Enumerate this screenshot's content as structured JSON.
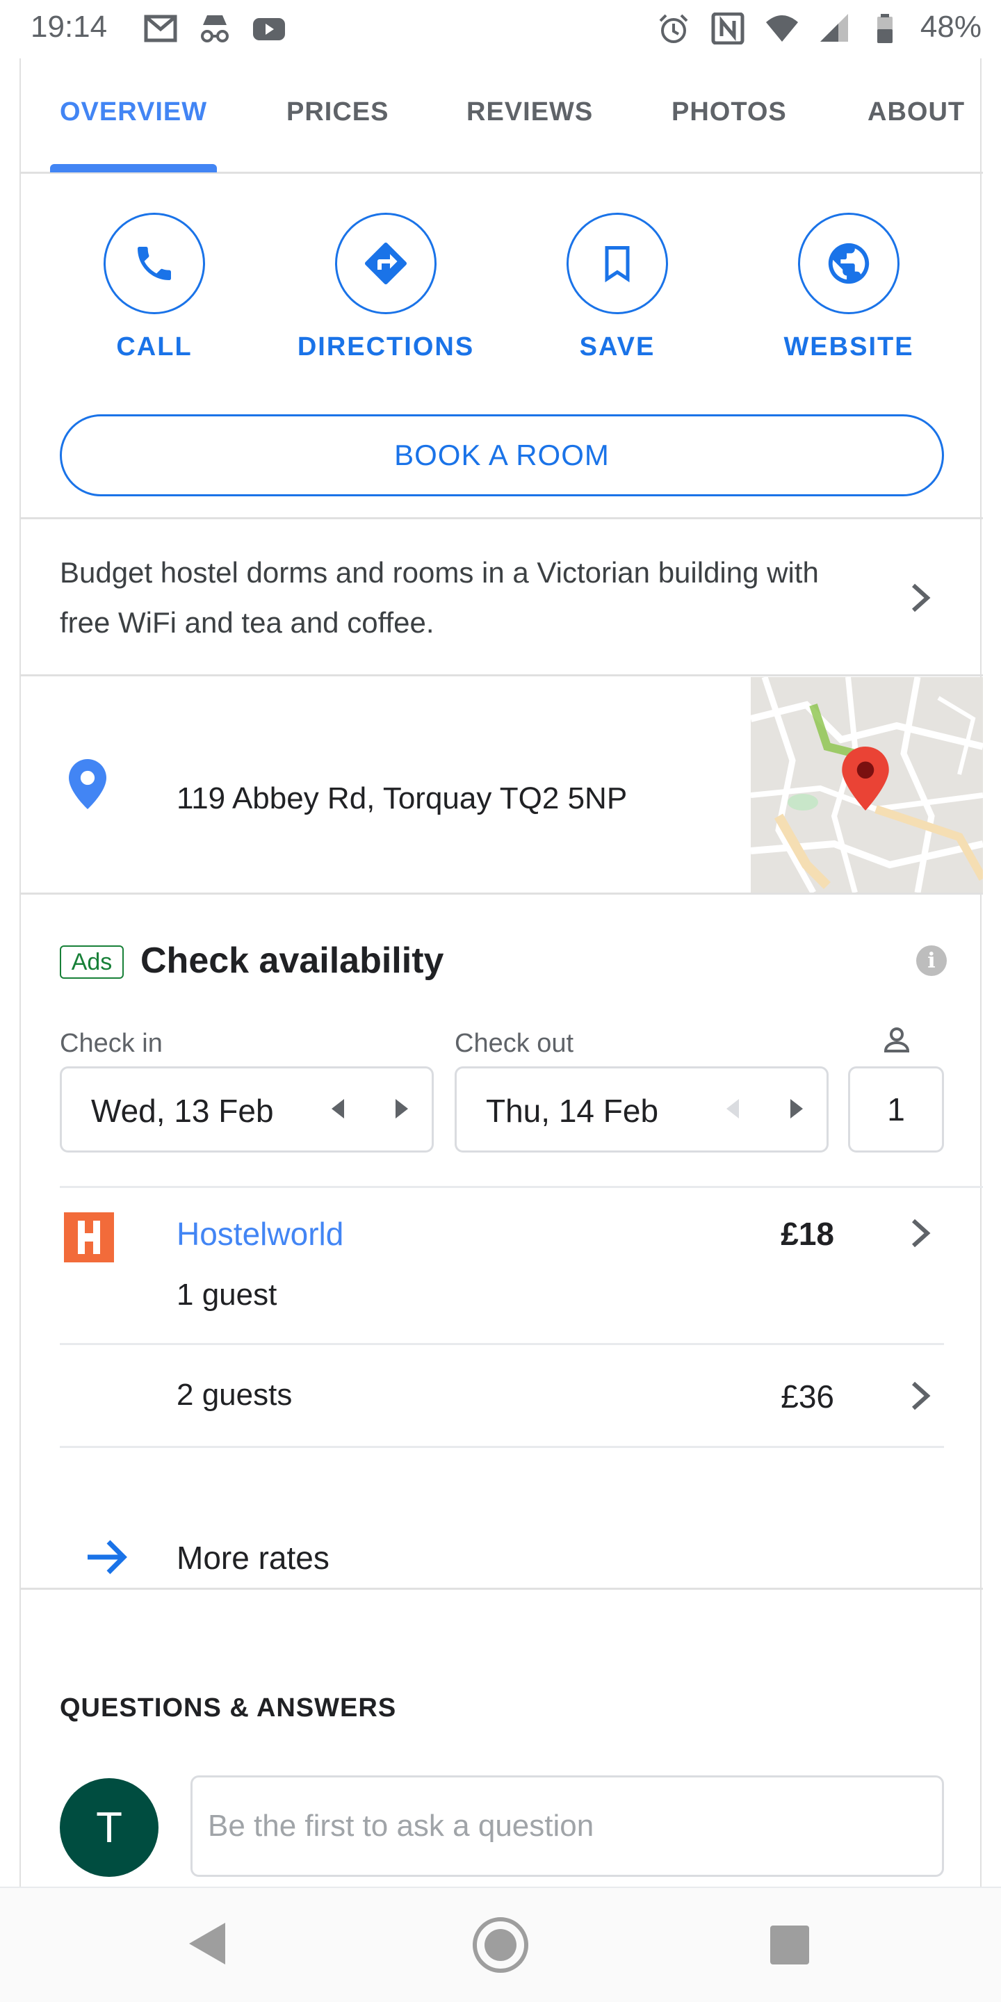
{
  "status_bar": {
    "time": "19:14",
    "battery": "48%",
    "icons": [
      "gmail-icon",
      "incognito-icon",
      "youtube-icon",
      "alarm-icon",
      "nfc-icon",
      "wifi-icon",
      "signal-icon",
      "battery-icon"
    ]
  },
  "tabs": [
    {
      "label": "OVERVIEW",
      "active": true
    },
    {
      "label": "PRICES",
      "active": false
    },
    {
      "label": "REVIEWS",
      "active": false
    },
    {
      "label": "PHOTOS",
      "active": false
    },
    {
      "label": "ABOUT",
      "active": false
    }
  ],
  "actions": {
    "call": "CALL",
    "directions": "DIRECTIONS",
    "save": "SAVE",
    "website": "WEBSITE"
  },
  "book_button": "BOOK A ROOM",
  "description": "Budget hostel dorms and rooms in a Victorian building with free WiFi and tea and coffee.",
  "address": "119 Abbey Rd, Torquay TQ2 5NP",
  "availability": {
    "ads_label": "Ads",
    "title": "Check availability",
    "check_in_label": "Check in",
    "check_in_value": "Wed, 13 Feb",
    "check_out_label": "Check out",
    "check_out_value": "Thu, 14 Feb",
    "guests": "1",
    "rates": [
      {
        "provider": "Hostelworld",
        "guests": "1 guest",
        "price": "£18"
      },
      {
        "guests": "2 guests",
        "price": "£36"
      }
    ],
    "more_rates": "More rates"
  },
  "qa": {
    "title": "QUESTIONS & ANSWERS",
    "avatar_letter": "T",
    "placeholder": "Be the first to ask a question"
  },
  "colors": {
    "accent": "#1a73e8",
    "link": "#4285f4",
    "ads_green": "#188038",
    "avatar_bg": "#004d40",
    "map_pin": "#ea4335",
    "provider_logo": "#f26b3a"
  }
}
